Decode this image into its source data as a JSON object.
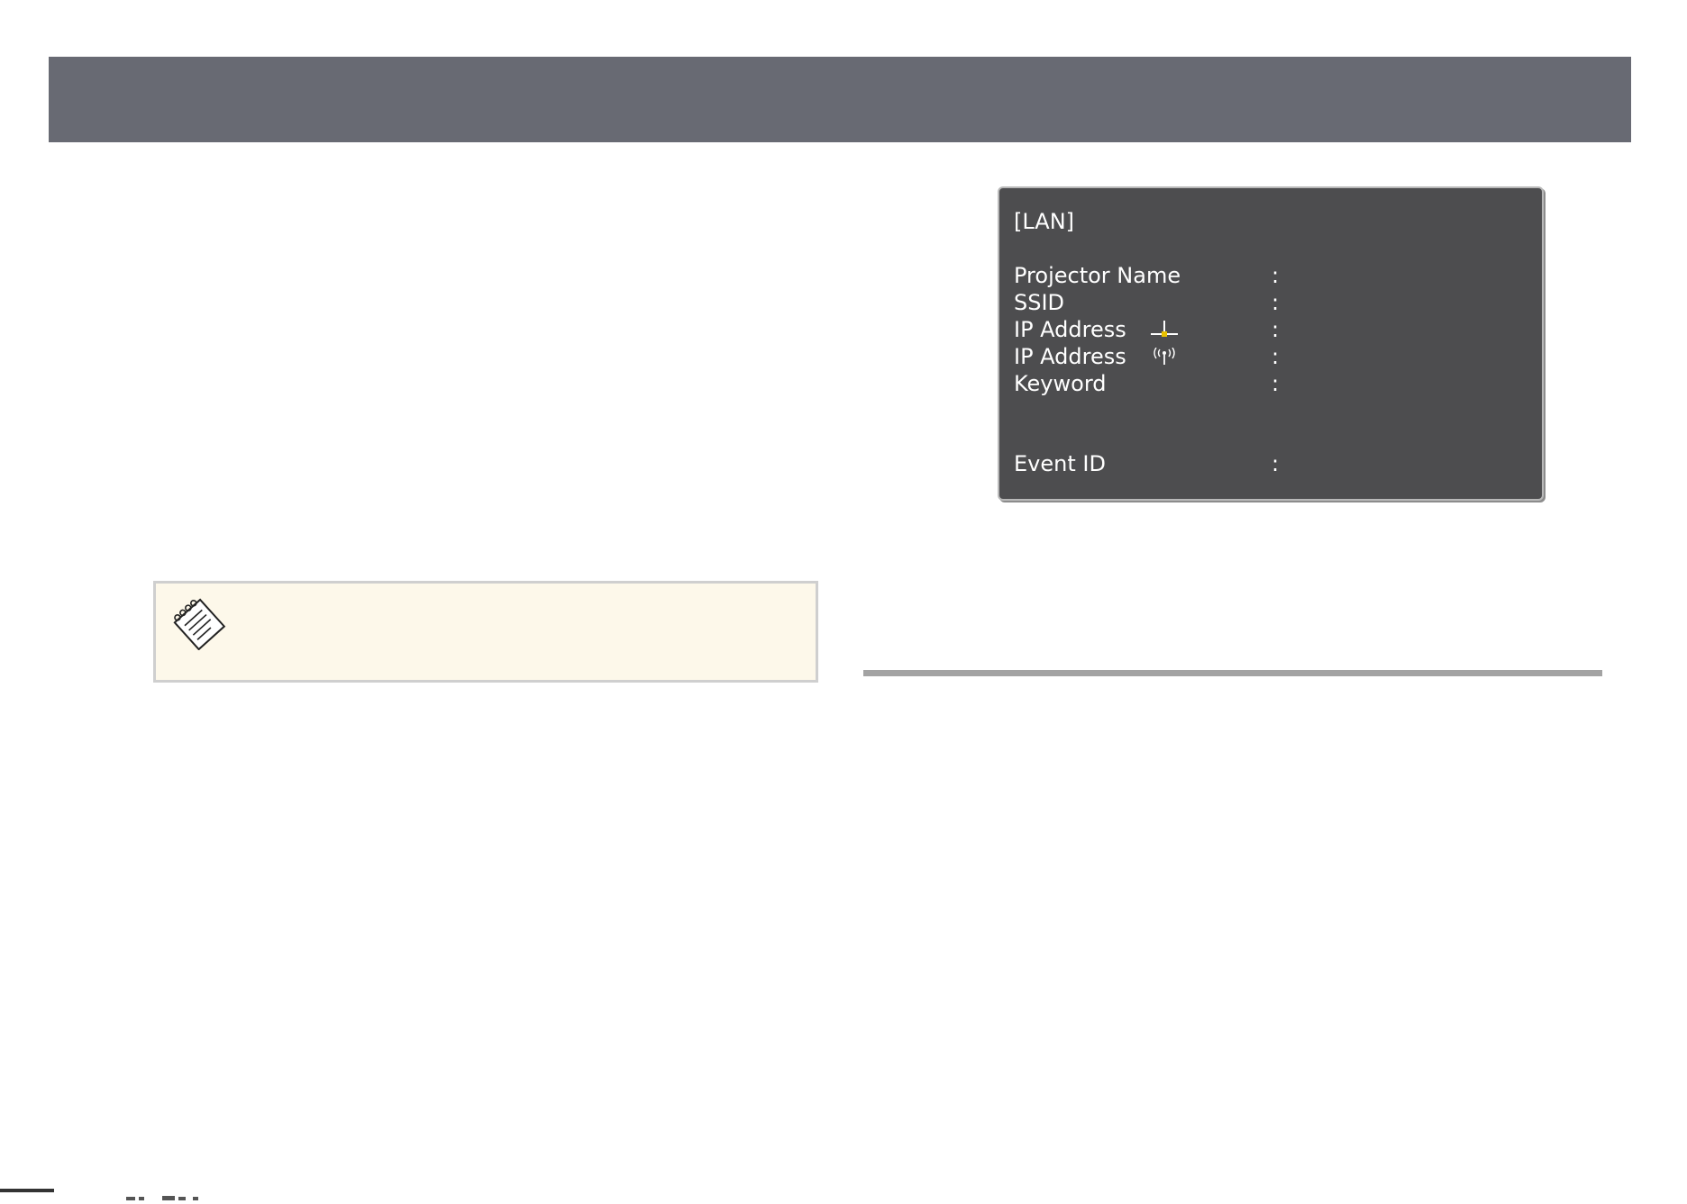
{
  "lan_screen": {
    "heading": "[LAN]",
    "rows": [
      {
        "label": "Projector Name",
        "colon": ":"
      },
      {
        "label": "SSID",
        "colon": ":"
      },
      {
        "label": "IP Address",
        "colon": ":",
        "icon": "wired-lan-icon"
      },
      {
        "label": "IP Address",
        "colon": ":",
        "icon": "wireless-lan-icon"
      },
      {
        "label": "Keyword",
        "colon": ":"
      },
      {
        "label": "Event ID",
        "colon": ":"
      }
    ],
    "colors": {
      "panel_background": "#4d4d4f",
      "text": "#ffffff",
      "wired_icon_accent": "#e8c000"
    }
  },
  "note": {
    "icon": "note-icon",
    "colors": {
      "background": "#fdf8ea",
      "border": "#cfcfcf"
    }
  },
  "colors": {
    "top_band": "#686a73",
    "section_rule": "#a3a3a3"
  }
}
